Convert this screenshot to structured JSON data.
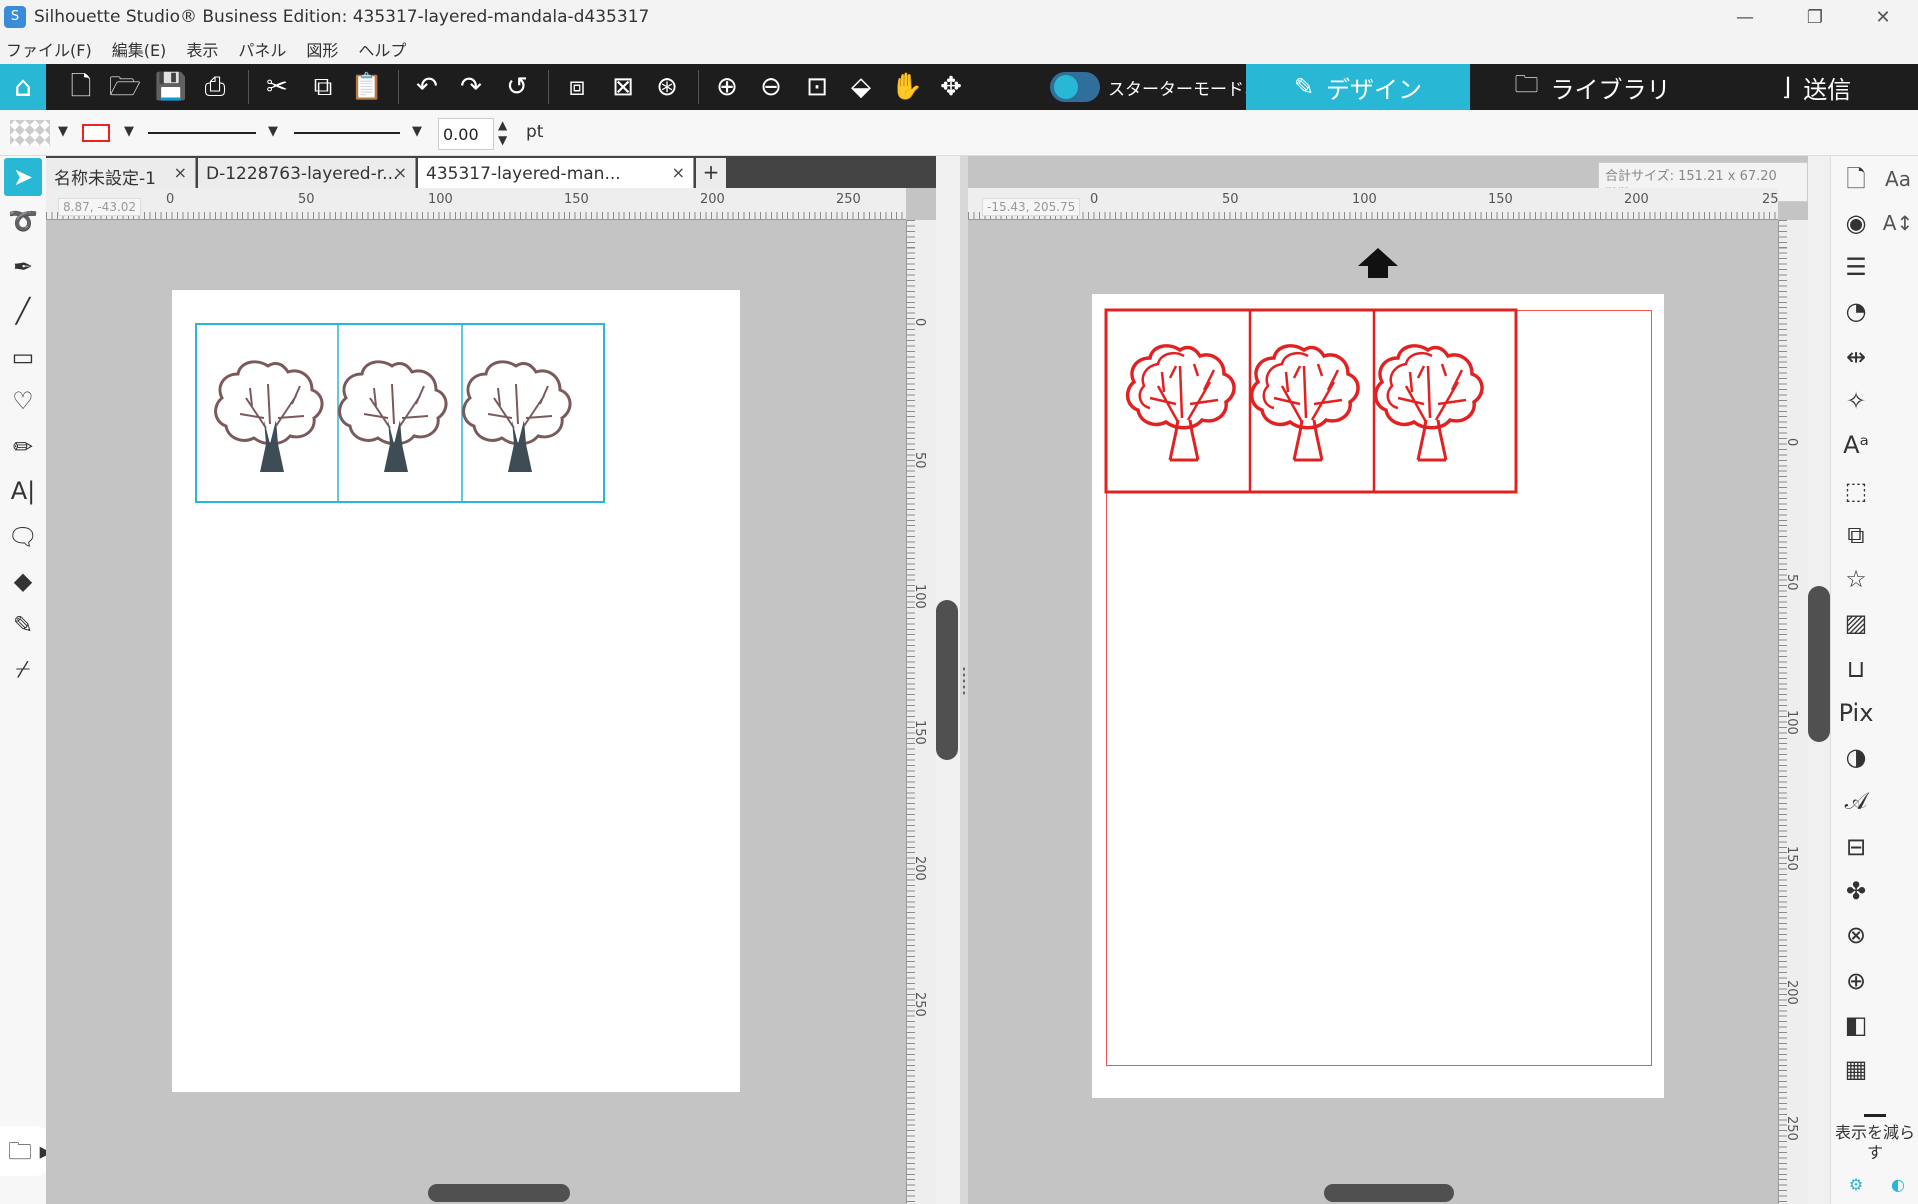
{
  "window": {
    "title": "Silhouette Studio® Business Edition: 435317-layered-mandala-d435317",
    "minimize": "—",
    "maximize": "❐",
    "close": "✕"
  },
  "menu": [
    "ファイル(F)",
    "編集(E)",
    "表示",
    "パネル",
    "図形",
    "ヘルプ"
  ],
  "toolbar": {
    "starter_mode": "スターターモードオフ",
    "tabs": {
      "design": "デザイン",
      "library": "ライブラリ",
      "send": "送信"
    }
  },
  "properties": {
    "line_weight": "0.00",
    "unit": "pt",
    "line_color": "#e22222"
  },
  "doc_tabs": [
    {
      "label": "名称未設定-1"
    },
    {
      "label": "D-1228763-layered-r..."
    },
    {
      "label": "435317-layered-man...",
      "active": true
    }
  ],
  "left_pane": {
    "coord": "8.87, -43.02",
    "ruler_h": [
      "0",
      "50",
      "100",
      "150",
      "200",
      "250"
    ],
    "ruler_v": [
      "0",
      "50",
      "100",
      "150",
      "200",
      "250"
    ]
  },
  "right_pane": {
    "coord": "-15.43, 205.75",
    "size": "合計サイズ: 151.21 x 67.20 mm",
    "ruler_h": [
      "0",
      "50",
      "100",
      "150",
      "200",
      "25"
    ],
    "ruler_v": [
      "0",
      "50",
      "100",
      "150",
      "200",
      "250"
    ]
  },
  "right_rail": {
    "reduce_label": "表示を減らす"
  },
  "colors": {
    "accent": "#29b7d6",
    "toolbar_bg": "#1d1d1d",
    "tree_trunk": "#3e4c55",
    "tree_outline": "#7a5a5a",
    "cut_line": "#e22222",
    "selection": "#29b7d6"
  }
}
